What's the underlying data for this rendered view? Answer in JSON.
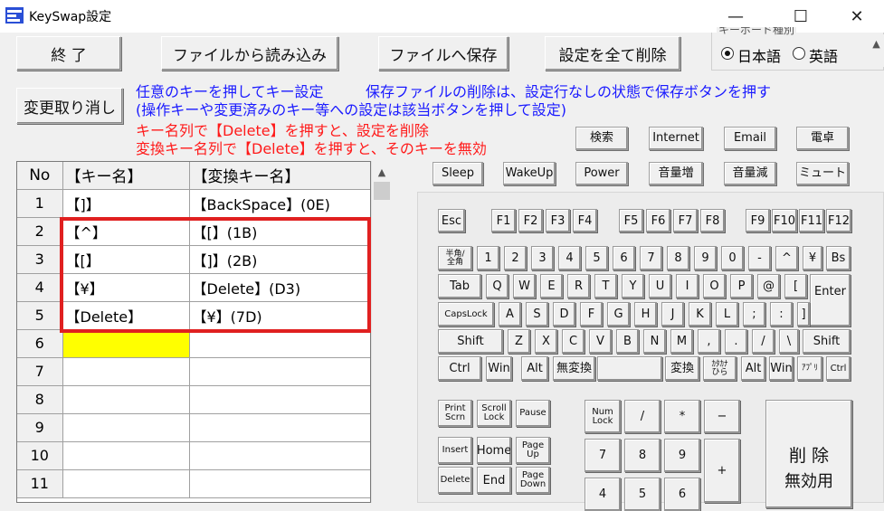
{
  "window": {
    "title": "KeySwap設定",
    "minimize": "—",
    "maximize": "☐",
    "close": "✕"
  },
  "toolbar": {
    "exit": "終 了",
    "load": "ファイルから読み込み",
    "save": "ファイルへ保存",
    "clear_all": "設定を全て削除",
    "undo": "変更取り消し"
  },
  "keyboard_type": {
    "label": "キーボード種別",
    "japanese": "日本語",
    "english": "英語",
    "selected": "japanese"
  },
  "info": {
    "blue_line1": "任意のキーを押してキー設定",
    "blue_line1b": "保存ファイルの削除は、設定行なしの状態で保存ボタンを押す",
    "blue_line2": "(操作キーや変更済みのキー等への設定は該当ボタンを押して設定)",
    "red_line1": "キー名列で【Delete】を押すと、設定を削除",
    "red_line2": "変換キー名列で【Delete】を押すと、そのキーを無効"
  },
  "grid": {
    "headers": {
      "no": "No",
      "key": "【キー名】",
      "mapped": "【変換キー名】"
    },
    "rows": [
      {
        "no": "1",
        "key": "【]】",
        "mapped": "【BackSpace】(0E)"
      },
      {
        "no": "2",
        "key": "【^】",
        "mapped": "【[】(1B)"
      },
      {
        "no": "3",
        "key": "【[】",
        "mapped": "【]】(2B)"
      },
      {
        "no": "4",
        "key": "【¥】",
        "mapped": "【Delete】(D3)"
      },
      {
        "no": "5",
        "key": "【Delete】",
        "mapped": "【¥】(7D)"
      },
      {
        "no": "6",
        "key": "",
        "mapped": ""
      },
      {
        "no": "7",
        "key": "",
        "mapped": ""
      },
      {
        "no": "8",
        "key": "",
        "mapped": ""
      },
      {
        "no": "9",
        "key": "",
        "mapped": ""
      },
      {
        "no": "10",
        "key": "",
        "mapped": ""
      },
      {
        "no": "11",
        "key": "",
        "mapped": ""
      }
    ]
  },
  "special_buttons": {
    "search": "検索",
    "internet": "Internet",
    "email": "Email",
    "calc": "電卓",
    "sleep": "Sleep",
    "wakeup": "WakeUp",
    "power": "Power",
    "vol_up": "音量増",
    "vol_down": "音量減",
    "mute": "ミュート"
  },
  "keys": {
    "esc": "Esc",
    "f1": "F1",
    "f2": "F2",
    "f3": "F3",
    "f4": "F4",
    "f5": "F5",
    "f6": "F6",
    "f7": "F7",
    "f8": "F8",
    "f9": "F9",
    "f10": "F10",
    "f11": "F11",
    "f12": "F12",
    "hankaku_1": "半角/",
    "hankaku_2": "全角",
    "n1": "1",
    "n2": "2",
    "n3": "3",
    "n4": "4",
    "n5": "5",
    "n6": "6",
    "n7": "7",
    "n8": "8",
    "n9": "9",
    "n0": "0",
    "minus": "-",
    "caret": "^",
    "yen": "¥",
    "bs": "Bs",
    "tab": "Tab",
    "q": "Q",
    "w": "W",
    "e": "E",
    "r": "R",
    "t": "T",
    "y": "Y",
    "u": "U",
    "i": "I",
    "o": "O",
    "p": "P",
    "at": "@",
    "lbracket": "[",
    "enter": "Enter",
    "caps": "CapsLock",
    "a": "A",
    "s": "S",
    "d": "D",
    "f": "F",
    "g": "G",
    "h": "H",
    "j": "J",
    "k": "K",
    "l": "L",
    "semicolon": ";",
    "colon": ":",
    "rbracket": "]",
    "lshift": "Shift",
    "z": "Z",
    "x": "X",
    "c": "C",
    "v": "V",
    "b": "B",
    "n": "N",
    "m": "M",
    "comma": ",",
    "period": ".",
    "slash": "/",
    "backslash": "\\",
    "rshift": "Shift",
    "lctrl": "Ctrl",
    "lwin": "Win",
    "lalt": "Alt",
    "muhenkan": "無変換",
    "henkan": "変換",
    "kana_1": "ｶﾀｶﾅ",
    "kana_2": "ひら",
    "ralt": "Alt",
    "rwin": "Win",
    "app": "ｱﾌﾟﾘ",
    "rctrl": "Ctrl",
    "prtsc_1": "Print",
    "prtsc_2": "Scrn",
    "scroll_1": "Scroll",
    "scroll_2": "Lock",
    "pause": "Pause",
    "insert": "Insert",
    "home": "Home",
    "pgup_1": "Page",
    "pgup_2": "Up",
    "delete": "Delete",
    "end": "End",
    "pgdn_1": "Page",
    "pgdn_2": "Down",
    "numlock_1": "Num",
    "numlock_2": "Lock",
    "np_div": "/",
    "np_mul": "*",
    "np_sub": "−",
    "np7": "7",
    "np8": "8",
    "np9": "9",
    "np_add": "+",
    "np4": "4",
    "np5": "5",
    "np6": "6"
  },
  "disable_panel": {
    "line1": "削 除",
    "line2": "無効用"
  }
}
